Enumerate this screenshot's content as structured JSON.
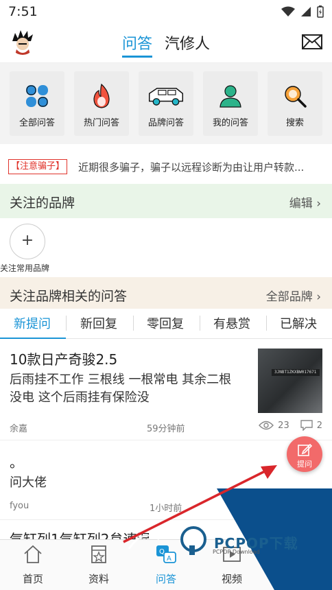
{
  "status": {
    "time": "7:51"
  },
  "header": {
    "tabs": [
      "问答",
      "汽修人"
    ],
    "active_tab": "问答"
  },
  "grid": {
    "items": [
      {
        "label": "全部问答",
        "icon": "four-petal-icon"
      },
      {
        "label": "热门问答",
        "icon": "flame-icon"
      },
      {
        "label": "品牌问答",
        "icon": "car-icon"
      },
      {
        "label": "我的问答",
        "icon": "person-icon"
      },
      {
        "label": "搜索",
        "icon": "search-icon"
      }
    ]
  },
  "notice": {
    "tag": "【注意骗子】",
    "text": "近期很多骗子，骗子以远程诊断为由让用户转款..."
  },
  "brand_section": {
    "title": "关注的品牌",
    "action": "编辑",
    "add_label": "关注常用品牌"
  },
  "related_section": {
    "title": "关注品牌相关的问答",
    "action": "全部品牌"
  },
  "subtabs": {
    "items": [
      "新提问",
      "新回复",
      "零回复",
      "有悬赏",
      "已解决"
    ],
    "active": "新提问"
  },
  "posts": [
    {
      "title": "10款日产奇骏2.5",
      "body_line1": "后雨挂不工作 三根线 一根常电 其余二根",
      "body_line2": "没电 这个后雨挂有保险没",
      "author": "余嘉",
      "time": "59分钟前",
      "views": "23",
      "comments": "2",
      "thumb_text": "3JNBT1ZKXBW017671"
    },
    {
      "title": "。",
      "body": "问大佬",
      "author": "fyou",
      "time": "1小时前"
    },
    {
      "title": "气缸列1气缸列2怠速混"
    }
  ],
  "fab": {
    "label": "提问"
  },
  "bottom_nav": {
    "items": [
      {
        "label": "首页",
        "icon": "home-icon"
      },
      {
        "label": "资料",
        "icon": "document-star-icon"
      },
      {
        "label": "问答",
        "icon": "qa-bubble-icon"
      },
      {
        "label": "视频",
        "icon": "video-icon"
      }
    ],
    "active": "问答"
  },
  "watermark": {
    "brand": "PCPOP下载",
    "sub": "PCPOP Download"
  },
  "colors": {
    "accent": "#1a94d6",
    "warning": "#e0322a",
    "fab": "#f26a6a",
    "watermark_blue": "#0b4f8c"
  }
}
